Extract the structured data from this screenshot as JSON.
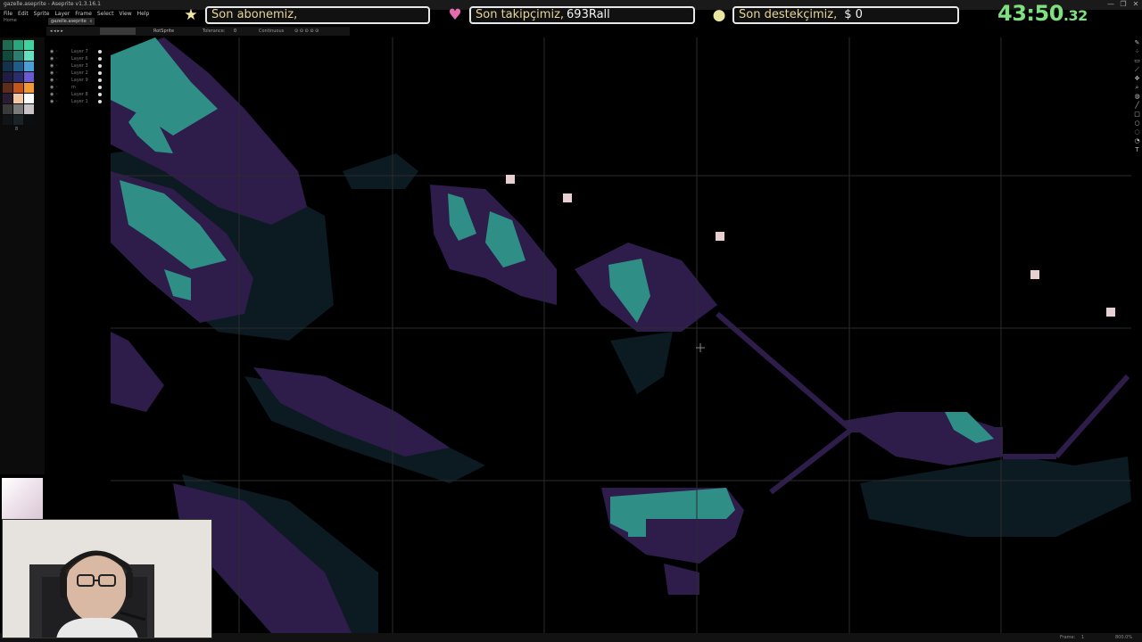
{
  "window": {
    "title": "gazelle.aseprite - Aseprite v1.3.16.1",
    "controls": [
      "—",
      "❐",
      "✕"
    ]
  },
  "menu": [
    "File",
    "Edit",
    "Sprite",
    "Layer",
    "Frame",
    "Select",
    "View",
    "Help"
  ],
  "tab": {
    "label": "gazelle.aseprite",
    "close": "x"
  },
  "home_label": "Home",
  "stream_overlay": {
    "subscriber": {
      "label": "Son abonemiz,",
      "value": "",
      "icon": "star-icon",
      "color": "#f3e7a4"
    },
    "follower": {
      "label": "Son takipçimiz,",
      "value": "693Rall",
      "icon": "heart-icon",
      "color": "#e46bb0"
    },
    "donor": {
      "label": "Son destekçimiz,",
      "value": "$ 0",
      "icon": "coin-icon",
      "color": "#e8e6a0"
    },
    "timer": {
      "main": "43:50",
      "fraction": ".32"
    }
  },
  "tool_options": {
    "mode": "RotSprite",
    "tolerance_label": "Tolerance:",
    "tolerance_value": "0",
    "contiguous_label": "Continuous"
  },
  "palette": {
    "colors": [
      "#1d6b52",
      "#2aa67c",
      "#3fd3a0",
      "#0f4a3a",
      "#2d7d6f",
      "#64e0c0",
      "#14334a",
      "#1f5d87",
      "#4aa0d4",
      "#201d44",
      "#2b2e6b",
      "#6a5bd0",
      "#5b2d1a",
      "#c2571e",
      "#f29b35",
      "#2a1c32",
      "#f2c8a2",
      "#ffffff",
      "#3a3a3a",
      "#7b7b7b",
      "#c9c2c7",
      "#111518",
      "#1a2428",
      "#0b0e10"
    ],
    "index_label": "8"
  },
  "layers": [
    {
      "name": "Layer 7"
    },
    {
      "name": "Layer 6"
    },
    {
      "name": "Layer 3"
    },
    {
      "name": "Layer 2"
    },
    {
      "name": "Layer 9"
    },
    {
      "name": "m"
    },
    {
      "name": "Layer 8"
    },
    {
      "name": "Layer 1"
    }
  ],
  "canvas": {
    "colors": {
      "dark": "#0c1a22",
      "purple": "#2e1c4a",
      "teal": "#2f8f86",
      "highlight": "#e8cfd2"
    }
  },
  "status": {
    "frame_label": "Frame:",
    "frame_value": "1",
    "zoom": "800.0%"
  }
}
